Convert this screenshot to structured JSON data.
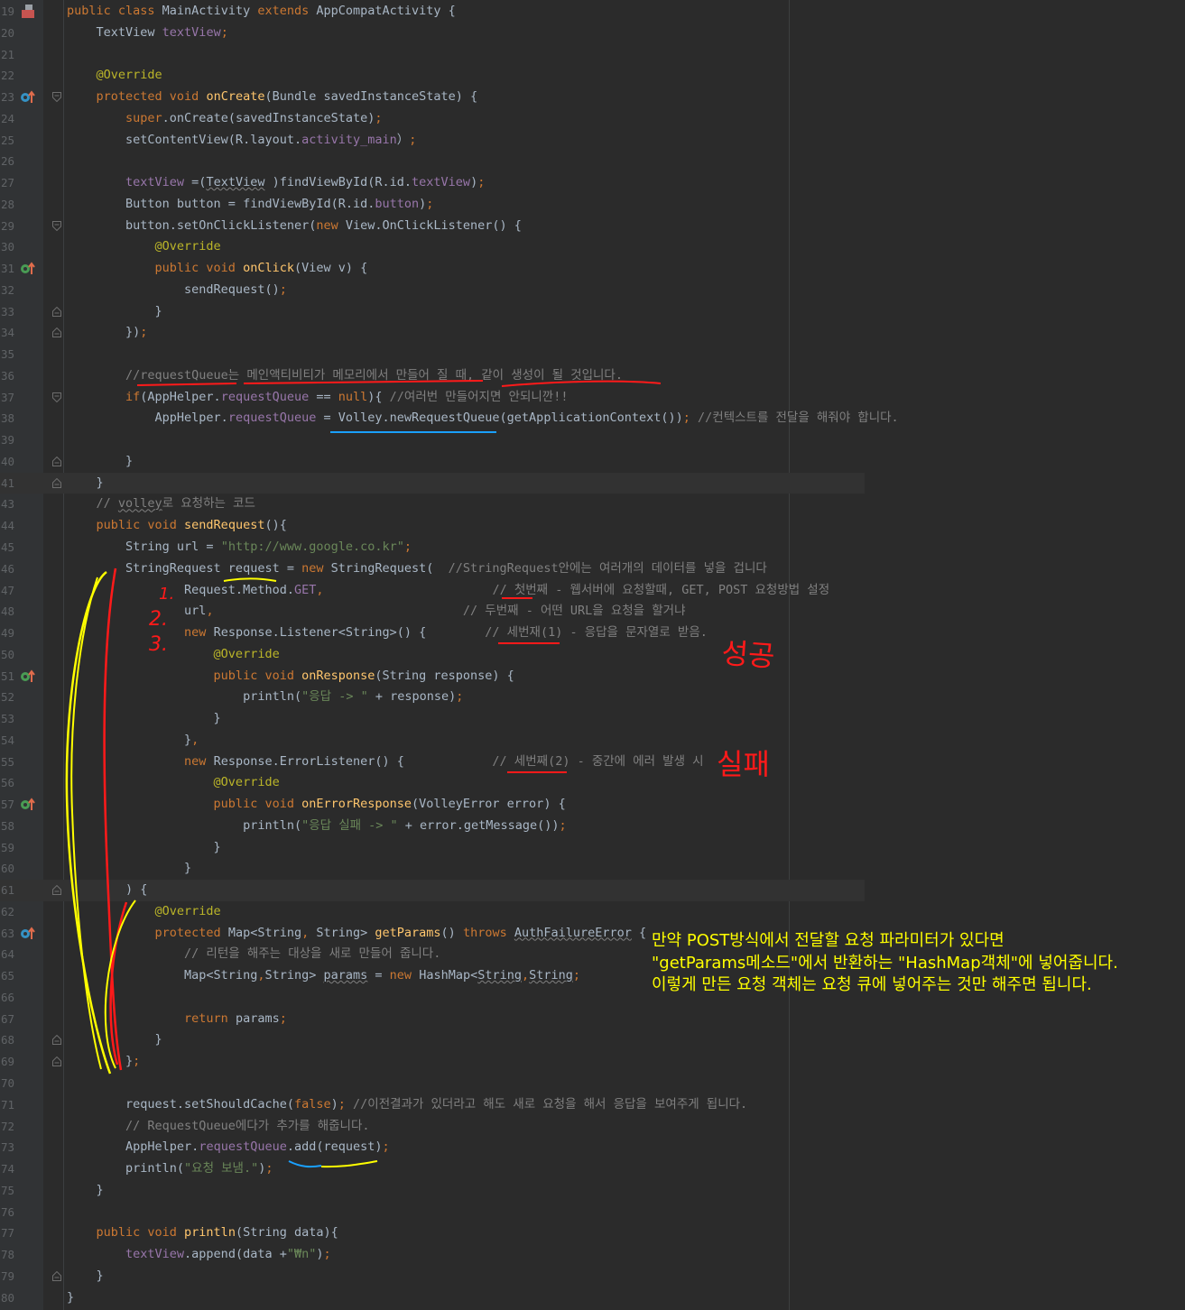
{
  "editor": {
    "lines": [
      {
        "n": "19",
        "segs": [
          [
            "kw",
            "public class "
          ],
          [
            "",
            "MainActivity "
          ],
          [
            "kw",
            "extends "
          ],
          [
            "",
            "AppCompatActivity {"
          ]
        ]
      },
      {
        "n": "20",
        "segs": [
          [
            "",
            "    TextView "
          ],
          [
            "fd",
            "textView"
          ],
          [
            "kw",
            ";"
          ]
        ]
      },
      {
        "n": "21",
        "segs": []
      },
      {
        "n": "22",
        "segs": [
          [
            "an",
            "    @Override"
          ]
        ]
      },
      {
        "n": "23",
        "segs": [
          [
            "kw",
            "    protected void "
          ],
          [
            "fn",
            "onCreate"
          ],
          [
            "",
            "(Bundle savedInstanceState) {"
          ]
        ]
      },
      {
        "n": "24",
        "segs": [
          [
            "kw",
            "        super"
          ],
          [
            "",
            ".onCreate(savedInstanceState)"
          ],
          [
            "kw",
            ";"
          ]
        ]
      },
      {
        "n": "25",
        "segs": [
          [
            "",
            "        setContentView(R.layout."
          ],
          [
            "fd",
            "activity_main"
          ],
          [
            "",
            "）"
          ],
          [
            "kw",
            ";"
          ]
        ]
      },
      {
        "n": "26",
        "segs": []
      },
      {
        "n": "27",
        "segs": [
          [
            "fd",
            "        textView "
          ],
          [
            "",
            "=("
          ],
          [
            "sq",
            "TextView"
          ],
          [
            "",
            " )findViewById(R.id."
          ],
          [
            "fd",
            "textView"
          ],
          [
            "",
            ")"
          ],
          [
            "kw",
            ";"
          ]
        ]
      },
      {
        "n": "28",
        "segs": [
          [
            "",
            "        Button button = findViewById(R.id."
          ],
          [
            "fd",
            "button"
          ],
          [
            "",
            ")"
          ],
          [
            "kw",
            ";"
          ]
        ]
      },
      {
        "n": "29",
        "segs": [
          [
            "",
            "        button.setOnClickListener("
          ],
          [
            "kw",
            "new "
          ],
          [
            "",
            "View.OnClickListener() {"
          ]
        ]
      },
      {
        "n": "30",
        "segs": [
          [
            "an",
            "            @Override"
          ]
        ]
      },
      {
        "n": "31",
        "segs": [
          [
            "kw",
            "            public void "
          ],
          [
            "fn",
            "onClick"
          ],
          [
            "",
            "(View v) {"
          ]
        ]
      },
      {
        "n": "32",
        "segs": [
          [
            "",
            "                sendRequest()"
          ],
          [
            "kw",
            ";"
          ]
        ]
      },
      {
        "n": "33",
        "segs": [
          [
            "",
            "            }"
          ]
        ]
      },
      {
        "n": "34",
        "segs": [
          [
            "",
            "        })"
          ],
          [
            "kw",
            ";"
          ]
        ]
      },
      {
        "n": "35",
        "segs": []
      },
      {
        "n": "36",
        "segs": [
          [
            "cm",
            "        //requestQueue는 메인액티비티가 메모리에서 만들어 질 때, 같이 생성이 될 것입니다."
          ]
        ]
      },
      {
        "n": "37",
        "segs": [
          [
            "kw",
            "        if"
          ],
          [
            "",
            "(AppHelper."
          ],
          [
            "fd",
            "requestQueue "
          ],
          [
            "",
            "== "
          ],
          [
            "kw",
            "null"
          ],
          [
            "",
            "){ "
          ],
          [
            "cm",
            "//여러번 만들어지면 안되니깐!!"
          ]
        ]
      },
      {
        "n": "38",
        "segs": [
          [
            "",
            "            AppHelper."
          ],
          [
            "fd",
            "requestQueue "
          ],
          [
            "",
            "= Volley.newRequestQueue(getApplicationContext())"
          ],
          [
            "kw",
            "; "
          ],
          [
            "cm",
            "//컨텍스트를 전달을 해줘야 합니다."
          ]
        ]
      },
      {
        "n": "39",
        "segs": []
      },
      {
        "n": "40",
        "segs": [
          [
            "",
            "        }"
          ]
        ]
      },
      {
        "n": "41",
        "segs": [
          [
            "",
            "    }"
          ]
        ],
        "cur": true
      },
      {
        "n": "43",
        "segs": [
          [
            "cm",
            "    // "
          ],
          [
            "cm sq",
            "volley"
          ],
          [
            "cm",
            "로 요청하는 코드"
          ]
        ]
      },
      {
        "n": "44",
        "segs": [
          [
            "kw",
            "    public void "
          ],
          [
            "fn",
            "sendRequest"
          ],
          [
            "",
            "(){"
          ]
        ]
      },
      {
        "n": "45",
        "segs": [
          [
            "",
            "        String url = "
          ],
          [
            "st",
            "\"http://www.google.co.kr\""
          ],
          [
            "kw",
            ";"
          ]
        ]
      },
      {
        "n": "46",
        "segs": [
          [
            "",
            "        StringRequest request = "
          ],
          [
            "kw",
            "new "
          ],
          [
            "",
            "StringRequest(  "
          ],
          [
            "cm",
            "//StringRequest안에는 여러개의 데이터를 넣을 겁니다"
          ]
        ]
      },
      {
        "n": "47",
        "segs": [
          [
            "",
            "                Request.Method."
          ],
          [
            "fd",
            "GET"
          ],
          [
            "kw",
            ","
          ],
          [
            "",
            "                       "
          ],
          [
            "cm",
            "// 첫번째 - 웹서버에 요청할때, GET, POST 요청방법 설정"
          ]
        ]
      },
      {
        "n": "48",
        "segs": [
          [
            "",
            "                url"
          ],
          [
            "kw",
            ","
          ],
          [
            "",
            "                                  "
          ],
          [
            "cm",
            "// 두번째 - 어떤 URL을 요청을 할거냐"
          ]
        ]
      },
      {
        "n": "49",
        "segs": [
          [
            "kw",
            "                new "
          ],
          [
            "",
            "Response.Listener<String>() {        "
          ],
          [
            "cm",
            "// 세번재(1) - 응답을 문자열로 받음."
          ]
        ]
      },
      {
        "n": "50",
        "segs": [
          [
            "an",
            "                    @Override"
          ]
        ]
      },
      {
        "n": "51",
        "segs": [
          [
            "kw",
            "                    public void "
          ],
          [
            "fn",
            "onResponse"
          ],
          [
            "",
            "(String response) {"
          ]
        ]
      },
      {
        "n": "52",
        "segs": [
          [
            "",
            "                        println("
          ],
          [
            "st",
            "\"응답 -> \" "
          ],
          [
            "",
            "+ response)"
          ],
          [
            "kw",
            ";"
          ]
        ]
      },
      {
        "n": "53",
        "segs": [
          [
            "",
            "                    }"
          ]
        ]
      },
      {
        "n": "54",
        "segs": [
          [
            "",
            "                }"
          ],
          [
            "kw",
            ","
          ]
        ]
      },
      {
        "n": "55",
        "segs": [
          [
            "kw",
            "                new "
          ],
          [
            "",
            "Response.ErrorListener() {            "
          ],
          [
            "cm",
            "// 세번째(2) - 중간에 에러 발생 시"
          ]
        ]
      },
      {
        "n": "56",
        "segs": [
          [
            "an",
            "                    @Override"
          ]
        ]
      },
      {
        "n": "57",
        "segs": [
          [
            "kw",
            "                    public void "
          ],
          [
            "fn",
            "onErrorResponse"
          ],
          [
            "",
            "(VolleyError error) {"
          ]
        ]
      },
      {
        "n": "58",
        "segs": [
          [
            "",
            "                        println("
          ],
          [
            "st",
            "\"응답 실패 -> \" "
          ],
          [
            "",
            "+ error.getMessage())"
          ],
          [
            "kw",
            ";"
          ]
        ]
      },
      {
        "n": "59",
        "segs": [
          [
            "",
            "                    }"
          ]
        ]
      },
      {
        "n": "60",
        "segs": [
          [
            "",
            "                }"
          ]
        ]
      },
      {
        "n": "61",
        "segs": [
          [
            "",
            "        ) {"
          ]
        ],
        "cur": true
      },
      {
        "n": "62",
        "segs": [
          [
            "an",
            "            @Override"
          ]
        ]
      },
      {
        "n": "63",
        "segs": [
          [
            "kw",
            "            protected "
          ],
          [
            "",
            "Map<String"
          ],
          [
            "kw",
            ", "
          ],
          [
            "",
            "String> "
          ],
          [
            "fn",
            "getParams"
          ],
          [
            "",
            "() "
          ],
          [
            "kw",
            "throws "
          ],
          [
            "sq",
            "AuthFailureError"
          ],
          [
            "",
            " {"
          ]
        ]
      },
      {
        "n": "64",
        "segs": [
          [
            "cm",
            "                // 리턴을 해주는 대상을 새로 만들어 줍니다."
          ]
        ]
      },
      {
        "n": "65",
        "segs": [
          [
            "",
            "                Map<String"
          ],
          [
            "kw",
            ","
          ],
          [
            "",
            "String> "
          ],
          [
            "sq",
            "params"
          ],
          [
            "",
            " = "
          ],
          [
            "kw",
            "new "
          ],
          [
            "",
            "HashMap<"
          ],
          [
            "sq",
            "String"
          ],
          [
            "kw",
            ","
          ],
          [
            "sq",
            "String"
          ],
          [
            ">()"
          ],
          [
            "kw",
            ";"
          ]
        ]
      },
      {
        "n": "66",
        "segs": []
      },
      {
        "n": "67",
        "segs": [
          [
            "kw",
            "                return "
          ],
          [
            "",
            "params"
          ],
          [
            "kw",
            ";"
          ]
        ]
      },
      {
        "n": "68",
        "segs": [
          [
            "",
            "            }"
          ]
        ]
      },
      {
        "n": "69",
        "segs": [
          [
            "",
            "        }"
          ],
          [
            "kw",
            ";"
          ]
        ]
      },
      {
        "n": "70",
        "segs": []
      },
      {
        "n": "71",
        "segs": [
          [
            "",
            "        request.setShouldCache("
          ],
          [
            "kw",
            "false"
          ],
          [
            "",
            ")"
          ],
          [
            "kw",
            "; "
          ],
          [
            "cm",
            "//이전결과가 있더라고 해도 새로 요청을 해서 응답을 보여주게 됩니다."
          ]
        ]
      },
      {
        "n": "72",
        "segs": [
          [
            "cm",
            "        // RequestQueue에다가 추가를 해줍니다."
          ]
        ]
      },
      {
        "n": "73",
        "segs": [
          [
            "",
            "        AppHelper."
          ],
          [
            "fd",
            "requestQueue"
          ],
          [
            "",
            ".add(request)"
          ],
          [
            "kw",
            ";"
          ]
        ]
      },
      {
        "n": "74",
        "segs": [
          [
            "",
            "        println("
          ],
          [
            "st",
            "\"요청 보냄.\""
          ],
          [
            "",
            ")"
          ],
          [
            "kw",
            ";"
          ]
        ]
      },
      {
        "n": "75",
        "segs": [
          [
            "",
            "    }"
          ]
        ]
      },
      {
        "n": "76",
        "segs": []
      },
      {
        "n": "77",
        "segs": [
          [
            "kw",
            "    public void "
          ],
          [
            "fn",
            "println"
          ],
          [
            "",
            "(String data){"
          ]
        ]
      },
      {
        "n": "78",
        "segs": [
          [
            "fd",
            "        textView"
          ],
          [
            "",
            ".append(data +"
          ],
          [
            "st",
            "\"₩n\""
          ],
          [
            "",
            ")"
          ],
          [
            "kw",
            ";"
          ]
        ]
      },
      {
        "n": "79",
        "segs": [
          [
            "",
            "    }"
          ]
        ]
      },
      {
        "n": "80",
        "segs": [
          [
            "",
            "}"
          ]
        ]
      }
    ]
  },
  "annotations": {
    "numbers": [
      "1.",
      "2.",
      "3."
    ],
    "success_label": "성공",
    "failure_label": "실패",
    "note_lines": [
      "만약 POST방식에서 전달할 요청 파라미터가 있다면",
      "\"getParams메소드\"에서 반환하는 \"HashMap객체\"에 넣어줍니다.",
      "이렇게 만든 요청 객체는 요청 큐에 넣어주는 것만 해주면 됩니다."
    ]
  },
  "colors": {
    "background": "#2b2b2b",
    "keyword": "#cc7832",
    "method": "#ffc66d",
    "field": "#9876aa",
    "string": "#6a8759",
    "comment": "#808080",
    "annotation": "#bbb529",
    "pen_red": "#ff1a1a",
    "pen_yellow": "#ffff00",
    "pen_blue": "#1aa0ff"
  }
}
